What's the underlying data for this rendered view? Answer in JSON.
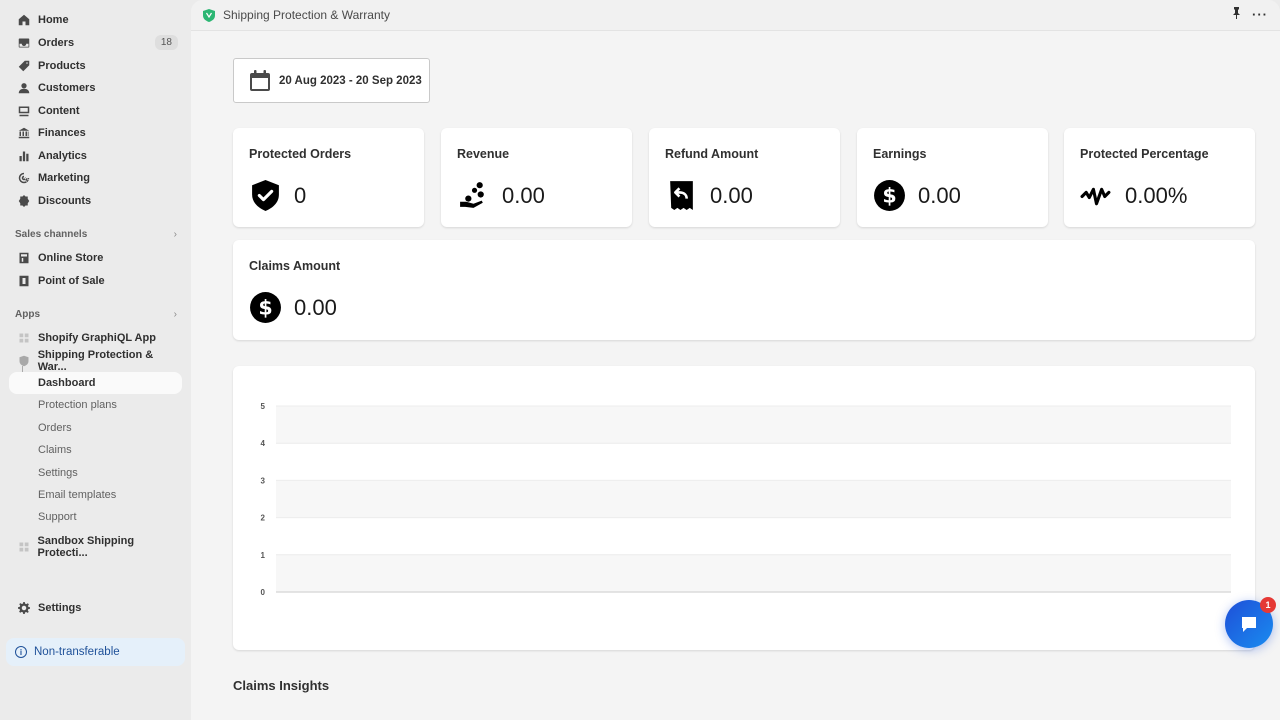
{
  "sidebar": {
    "nav": [
      {
        "label": "Home",
        "icon": "home-icon"
      },
      {
        "label": "Orders",
        "icon": "inbox-icon",
        "badge": "18"
      },
      {
        "label": "Products",
        "icon": "tag-icon"
      },
      {
        "label": "Customers",
        "icon": "person-icon"
      },
      {
        "label": "Content",
        "icon": "content-icon"
      },
      {
        "label": "Finances",
        "icon": "bank-icon"
      },
      {
        "label": "Analytics",
        "icon": "bar-chart-icon"
      },
      {
        "label": "Marketing",
        "icon": "target-icon"
      },
      {
        "label": "Discounts",
        "icon": "discount-icon"
      }
    ],
    "sales_channels": {
      "label": "Sales channels",
      "items": [
        {
          "label": "Online Store",
          "icon": "store-icon"
        },
        {
          "label": "Point of Sale",
          "icon": "pos-icon"
        }
      ]
    },
    "apps": {
      "label": "Apps",
      "items": [
        {
          "label": "Shopify GraphiQL App",
          "icon": "app-icon"
        },
        {
          "label": "Shipping Protection & War...",
          "icon": "shield-app-icon"
        }
      ],
      "sub_items": [
        {
          "label": "Dashboard",
          "active": true
        },
        {
          "label": "Protection plans"
        },
        {
          "label": "Orders"
        },
        {
          "label": "Claims"
        },
        {
          "label": "Settings"
        },
        {
          "label": "Email templates"
        },
        {
          "label": "Support"
        }
      ],
      "extra": {
        "label": "Sandbox Shipping Protecti...",
        "icon": "app-icon"
      }
    },
    "settings": {
      "label": "Settings",
      "icon": "gear-icon"
    },
    "notice": {
      "label": "Non-transferable",
      "icon": "info-icon"
    }
  },
  "topbar": {
    "title": "Shipping Protection & Warranty",
    "brand_color": "#2bb673"
  },
  "date_range": {
    "label": "20 Aug 2023 - 20 Sep 2023"
  },
  "stats": [
    {
      "title": "Protected Orders",
      "value": "0",
      "icon": "shield-check-icon"
    },
    {
      "title": "Revenue",
      "value": "0.00",
      "icon": "hand-coins-icon"
    },
    {
      "title": "Refund Amount",
      "value": "0.00",
      "icon": "receipt-refund-icon"
    },
    {
      "title": "Earnings",
      "value": "0.00",
      "icon": "dollar-circle-icon"
    },
    {
      "title": "Protected Percentage",
      "value": "0.00%",
      "icon": "activity-icon"
    }
  ],
  "claims_amount": {
    "title": "Claims Amount",
    "value": "0.00",
    "icon": "dollar-circle-icon"
  },
  "chart_data": {
    "type": "line",
    "title": "",
    "xlabel": "",
    "ylabel": "",
    "x": [],
    "series": [],
    "ylim": [
      0,
      5
    ],
    "yticks": [
      "0",
      "1",
      "2",
      "3",
      "4",
      "5"
    ],
    "grid": true
  },
  "claims_insights": {
    "heading": "Claims Insights"
  },
  "chat": {
    "notification_count": "1",
    "accent": "#1e5fe0"
  }
}
